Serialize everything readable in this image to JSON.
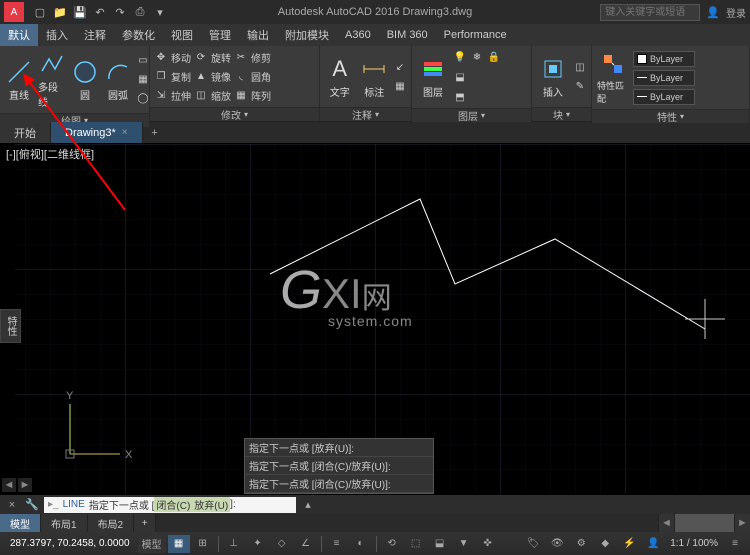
{
  "titlebar": {
    "app": "A",
    "title": "Autodesk AutoCAD 2016   Drawing3.dwg",
    "search_placeholder": "键入关键字或短语",
    "sign_in": "登录"
  },
  "menus": [
    "默认",
    "插入",
    "注释",
    "参数化",
    "视图",
    "管理",
    "输出",
    "附加模块",
    "A360",
    "BIM 360",
    "Performance"
  ],
  "ribbon": {
    "draw": {
      "line": "直线",
      "pline": "多段线",
      "circle": "圆",
      "arc": "圆弧",
      "title": "绘图"
    },
    "modify": {
      "move": "移动",
      "rotate": "旋转",
      "trim": "修剪",
      "copy": "复制",
      "mirror": "镜像",
      "fillet": "圆角",
      "stretch": "拉伸",
      "scale": "缩放",
      "array": "阵列",
      "title": "修改"
    },
    "annot": {
      "text": "文字",
      "title": "注释",
      "dim": "标注"
    },
    "layers": {
      "title": "图层",
      "btn": "图层"
    },
    "block": {
      "title": "块",
      "btn": "插入"
    },
    "props": {
      "title": "特性",
      "btn": "特性匹配",
      "bylayer": "ByLayer"
    }
  },
  "doctabs": {
    "start": "开始",
    "drawing": "Drawing3*"
  },
  "view_label": "[-][俯视][二维线框]",
  "side_tab": "特性",
  "watermark": {
    "main": "GXI",
    "net": "网",
    "sub": "system.com"
  },
  "cmd_history": [
    "指定下一点或 [放弃(U)]:",
    "指定下一点或 [闭合(C)/放弃(U)]:",
    "指定下一点或 [闭合(C)/放弃(U)]:"
  ],
  "cmdline": {
    "cmd": "LINE",
    "prompt": "指定下一点或 [",
    "opt1": "闭合(C)",
    "mid": " ",
    "opt2": "放弃(U)",
    "end": "]:"
  },
  "layout_tabs": [
    "模型",
    "布局1",
    "布局2"
  ],
  "status": {
    "coords": "287.3797, 70.2458, 0.0000",
    "model": "模型",
    "zoom": "1:1 / 100%"
  }
}
